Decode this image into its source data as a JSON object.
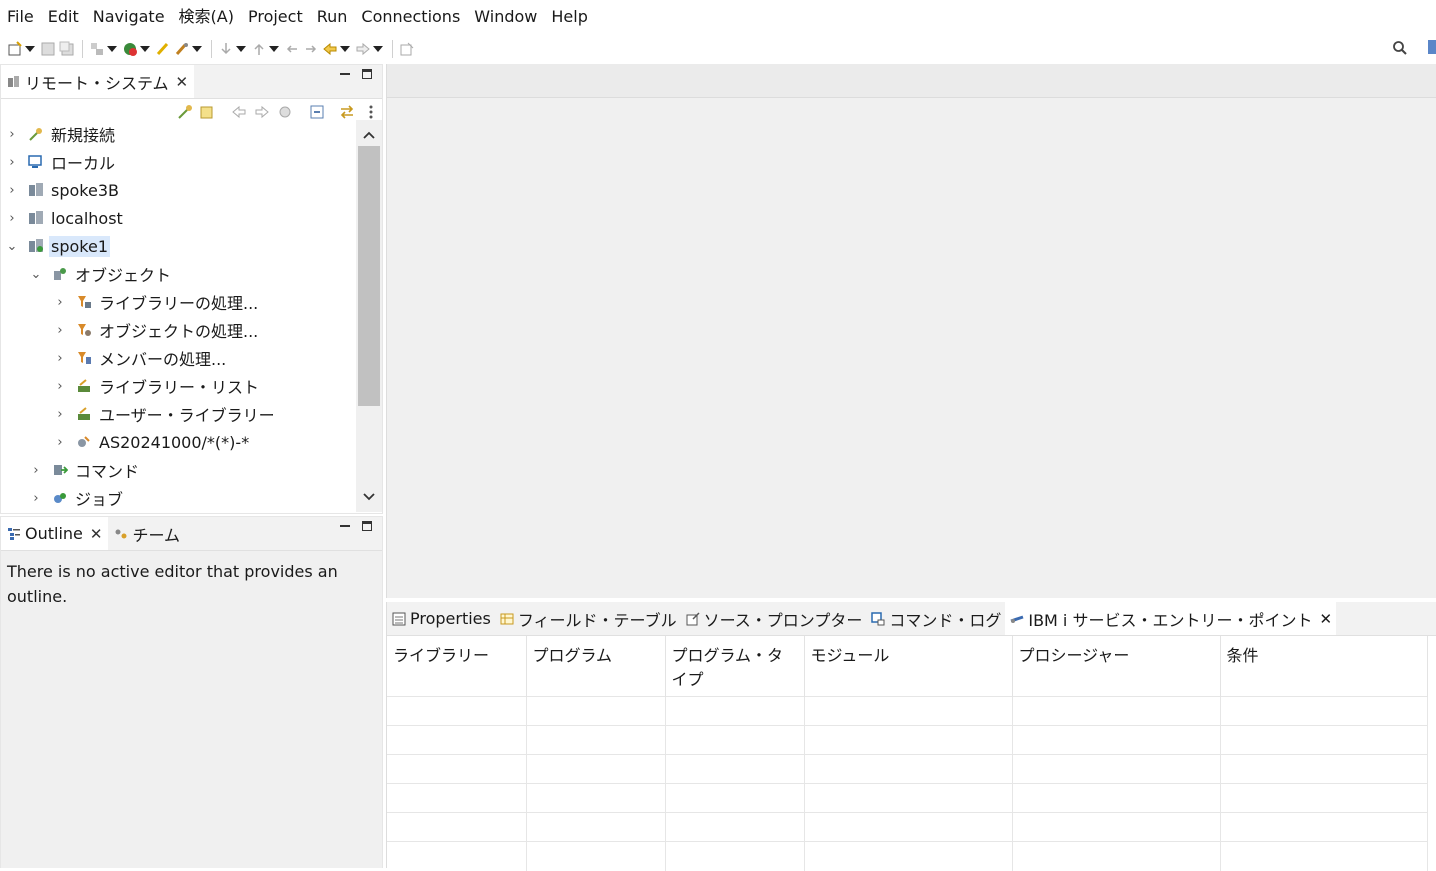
{
  "menu": [
    "File",
    "Edit",
    "Navigate",
    "検索(A)",
    "Project",
    "Run",
    "Connections",
    "Window",
    "Help"
  ],
  "remote_view": {
    "tab_title": "リモート・システム",
    "tree": [
      {
        "label": "新規接続",
        "expanded": false,
        "level": 0
      },
      {
        "label": "ローカル",
        "expanded": false,
        "level": 0
      },
      {
        "label": "spoke3B",
        "expanded": false,
        "level": 0
      },
      {
        "label": "localhost",
        "expanded": false,
        "level": 0
      },
      {
        "label": "spoke1",
        "expanded": true,
        "level": 0,
        "selected": true
      },
      {
        "label": "オブジェクト",
        "expanded": true,
        "level": 1
      },
      {
        "label": "ライブラリーの処理...",
        "expanded": false,
        "level": 2
      },
      {
        "label": "オブジェクトの処理...",
        "expanded": false,
        "level": 2
      },
      {
        "label": "メンバーの処理...",
        "expanded": false,
        "level": 2
      },
      {
        "label": "ライブラリー・リスト",
        "expanded": false,
        "level": 2
      },
      {
        "label": "ユーザー・ライブラリー",
        "expanded": false,
        "level": 2
      },
      {
        "label": "AS20241000/*(*)-*",
        "expanded": false,
        "level": 2
      },
      {
        "label": "コマンド",
        "expanded": false,
        "level": 1
      },
      {
        "label": "ジョブ",
        "expanded": false,
        "level": 1
      }
    ]
  },
  "outline_view": {
    "tabs": [
      "Outline",
      "チーム"
    ],
    "message": "There is no active editor that provides an outline."
  },
  "bottom_panel": {
    "tabs": [
      "Properties",
      "フィールド・テーブル",
      "ソース・プロンプター",
      "コマンド・ログ",
      "IBM i サービス・エントリー・ポイント"
    ],
    "active_tab": "IBM i サービス・エントリー・ポイント",
    "columns": [
      "ライブラリー",
      "プログラム",
      "プログラム・タイプ",
      "モジュール",
      "プロシージャー",
      "条件"
    ],
    "empty_rows": 6
  }
}
